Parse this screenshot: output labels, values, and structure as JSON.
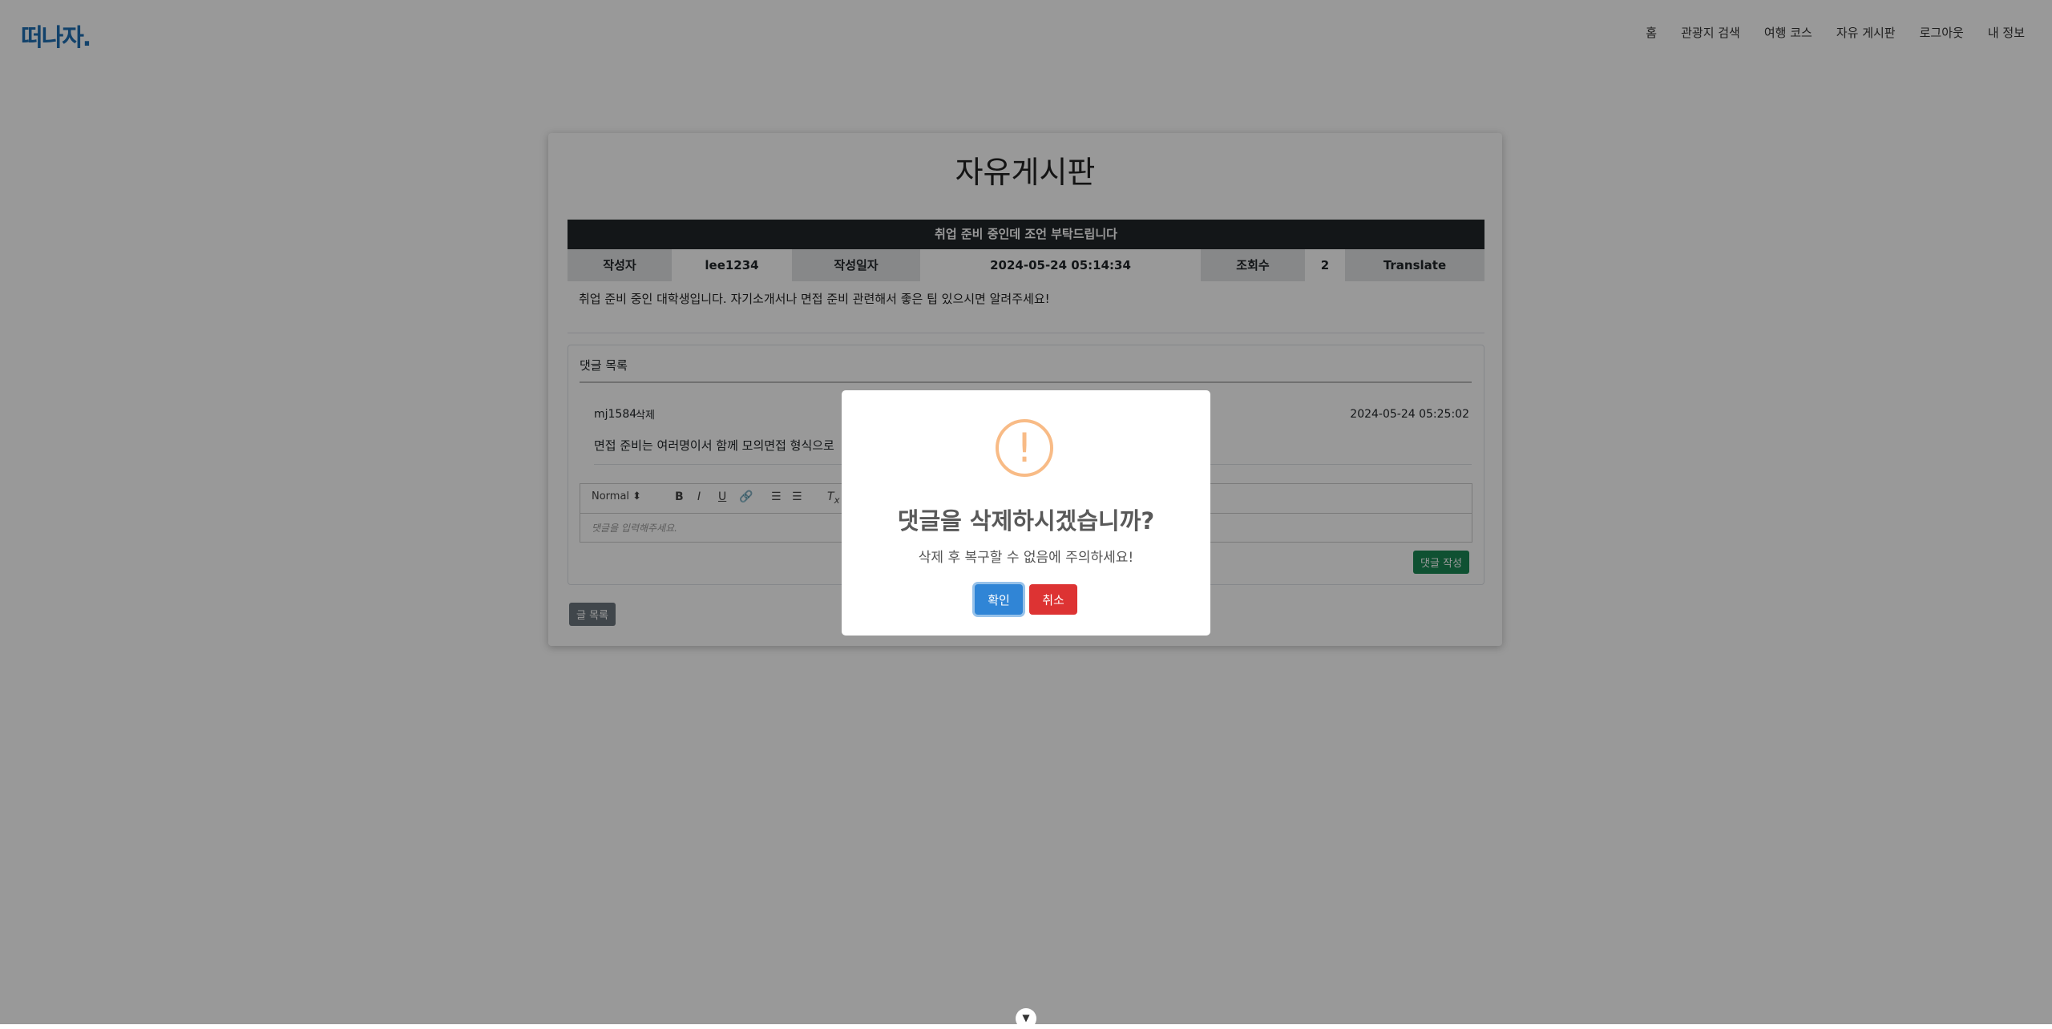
{
  "nav": {
    "logo": "떠나자.",
    "links": [
      "홈",
      "관광지 검색",
      "여행 코스",
      "자유 게시판",
      "로그아웃",
      "내 정보"
    ]
  },
  "board": {
    "title": "자유게시판",
    "post_title": "취업 준비 중인데 조언 부탁드립니다",
    "author_label": "작성자",
    "author": "lee1234",
    "date_label": "작성일자",
    "date": "2024-05-24 05:14:34",
    "views_label": "조회수",
    "views": "2",
    "translate_label": "Translate",
    "body": "취업 준비 중인 대학생입니다. 자기소개서나 면접 준비 관련해서 좋은 팁 있으시면 알려주세요!"
  },
  "comments": {
    "title": "댓글 목록",
    "items": [
      {
        "author": "mj1584",
        "delete_label": "삭제",
        "date": "2024-05-24 05:25:02",
        "text": "면접 준비는 여러명이서 함께 모의면접 형식으로"
      }
    ],
    "editor": {
      "format_select": "Normal",
      "placeholder": "댓글을 입력해주세요."
    },
    "write_button": "댓글 작성",
    "list_button": "글 목록"
  },
  "modal": {
    "icon": "warning-icon",
    "icon_glyph": "!",
    "title": "댓글을 삭제하시겠습니까?",
    "text": "삭제 후 복구할 수 없음에 주의하세요!",
    "confirm": "확인",
    "cancel": "취소"
  },
  "colors": {
    "confirm": "#3085d6",
    "cancel": "#dd3333",
    "write_button": "#198754",
    "warning": "#f8bb86"
  }
}
